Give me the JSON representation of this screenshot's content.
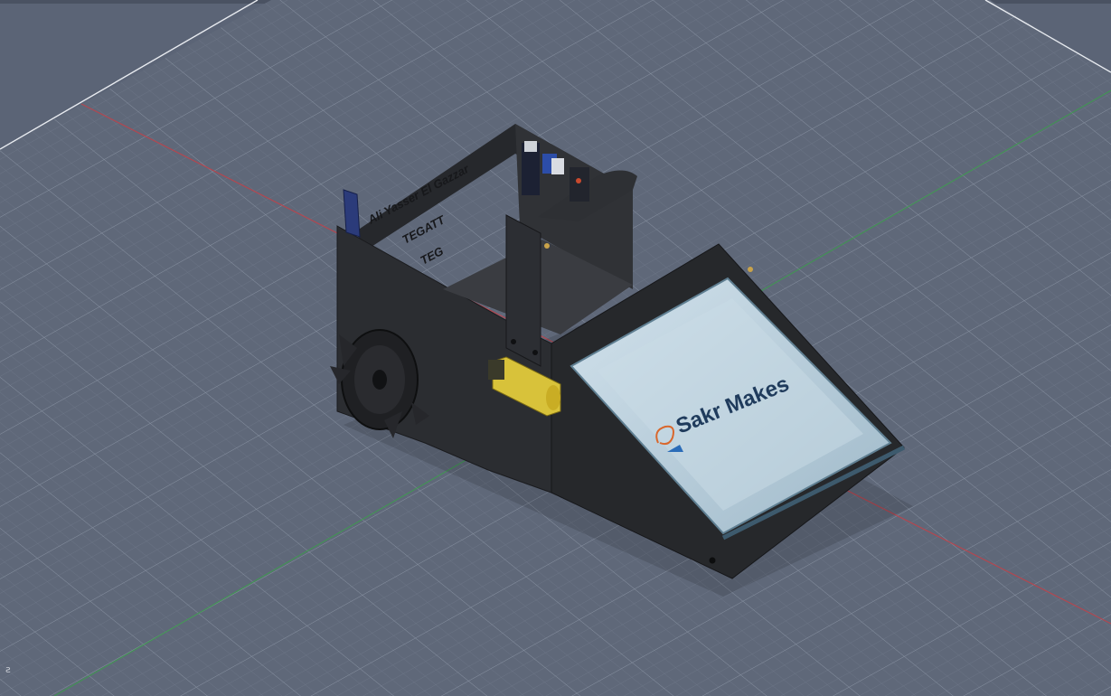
{
  "viewport": {
    "background": "#5b6476",
    "grid_color": "#7d8799",
    "axis_x_color": "#c0424a",
    "axis_y_color": "#3f9a50",
    "corner_glyph": "ƨ"
  },
  "model": {
    "logo_text": "Sakr Makes",
    "engraving_lines": [
      "Ali Yasser El Gazzar",
      "TEGATT",
      "TEG"
    ],
    "colors": {
      "body": "#2b2d31",
      "body_dark": "#1d1f22",
      "tray_glass": "#b8cfdc",
      "motor": "#d8c23a",
      "electronics": "#2c4da8",
      "logo": "#1f3b5c",
      "logo_accent": "#d9672c"
    }
  }
}
